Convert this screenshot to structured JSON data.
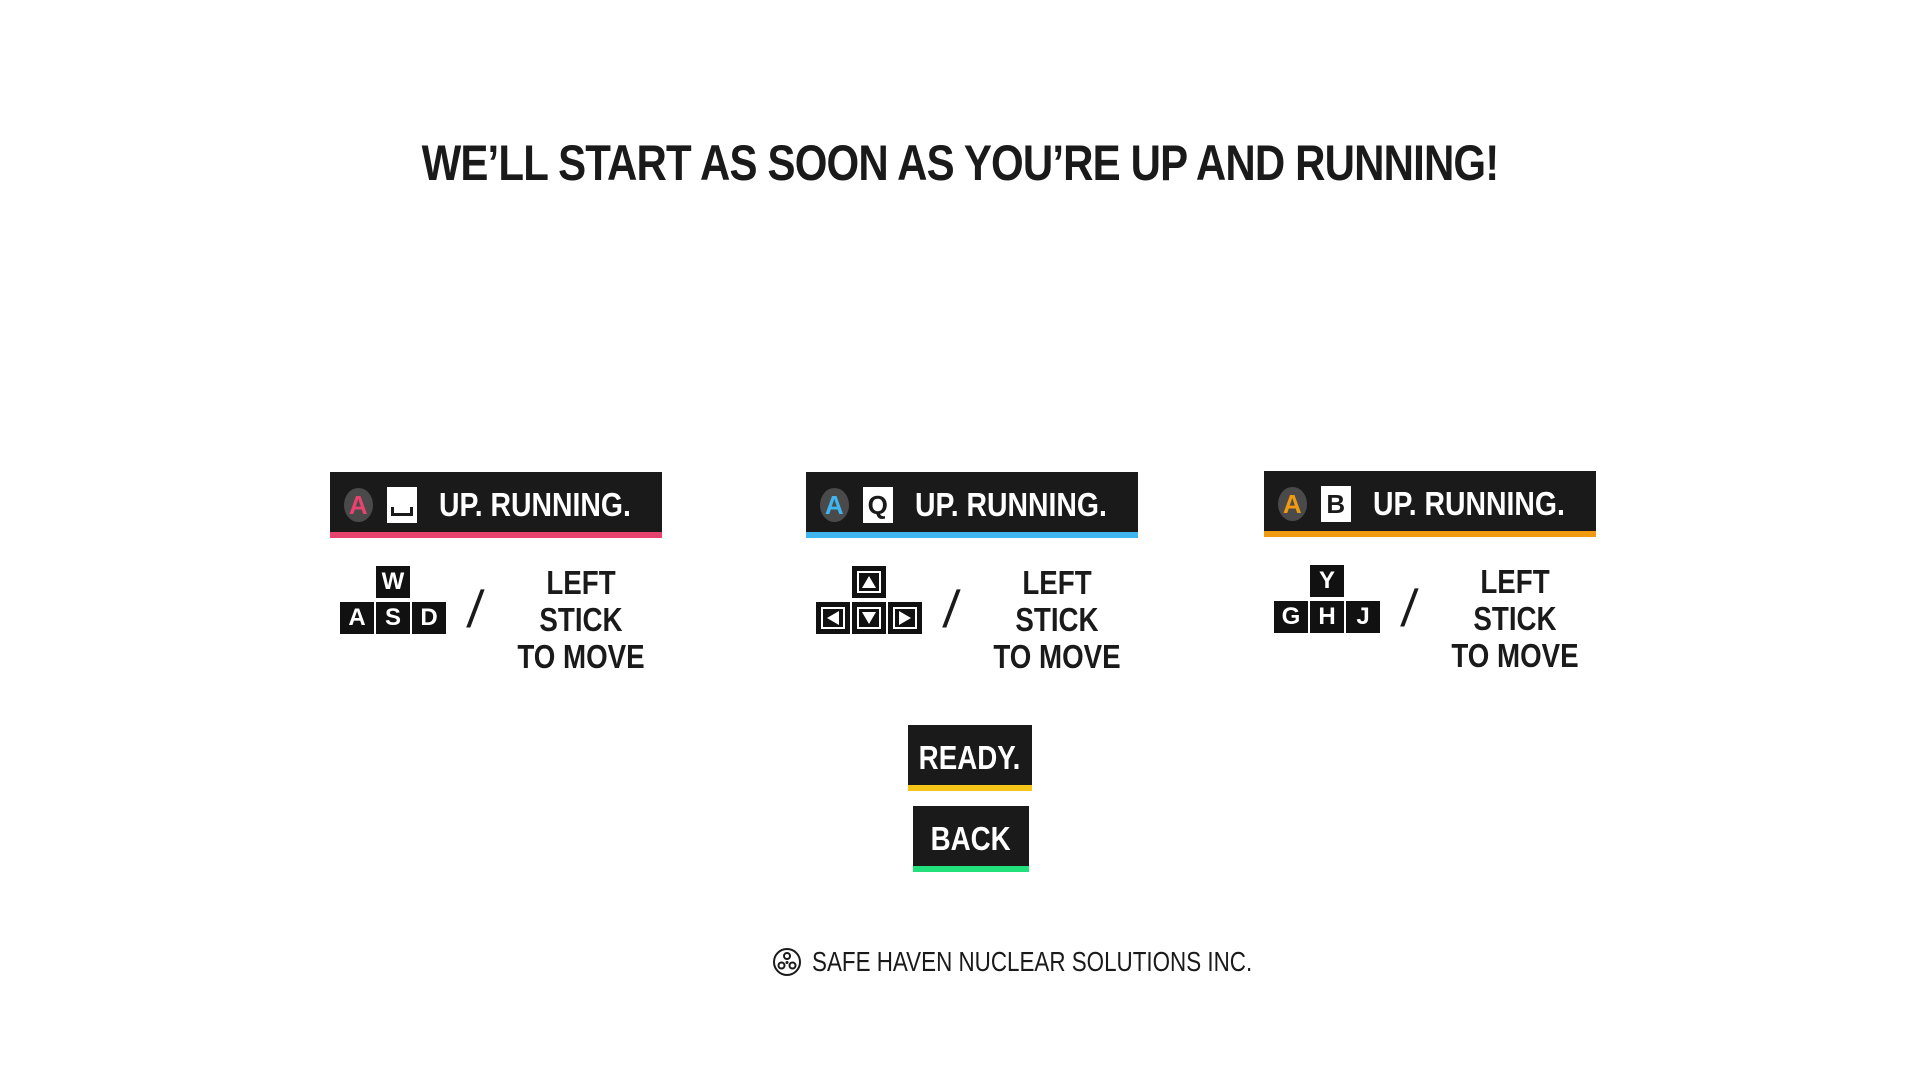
{
  "headline": "WE’LL START AS SOON AS YOU’RE UP AND RUNNING!",
  "players": [
    {
      "accent": "#e8436e",
      "a_badge": "A",
      "join_key": "",
      "join_key_icon": "spacebar-icon",
      "banner_label": "UP. RUNNING.",
      "move_keys": {
        "up": "W",
        "left": "A",
        "down": "S",
        "right": "D"
      },
      "slash": "/",
      "stick_line1": "LEFT STICK",
      "stick_line2": "TO MOVE"
    },
    {
      "accent": "#3fb6ef",
      "a_badge": "A",
      "join_key": "Q",
      "banner_label": "UP. RUNNING.",
      "move_keys_icons": [
        "arrow-up-icon",
        "arrow-left-icon",
        "arrow-down-icon",
        "arrow-right-icon"
      ],
      "slash": "/",
      "stick_line1": "LEFT STICK",
      "stick_line2": "TO MOVE"
    },
    {
      "accent": "#f09a12",
      "a_badge": "A",
      "join_key": "B",
      "banner_label": "UP. RUNNING.",
      "move_keys": {
        "up": "Y",
        "left": "G",
        "down": "H",
        "right": "J"
      },
      "slash": "/",
      "stick_line1": "LEFT STICK",
      "stick_line2": "TO MOVE"
    }
  ],
  "buttons": {
    "ready": {
      "label": "READY.",
      "accent": "#f5c518"
    },
    "back": {
      "label": "BACK",
      "accent": "#22e07a"
    }
  },
  "footer": {
    "logo_icon": "radiation-logo-icon",
    "text": "SAFE HAVEN NUCLEAR SOLUTIONS INC."
  }
}
